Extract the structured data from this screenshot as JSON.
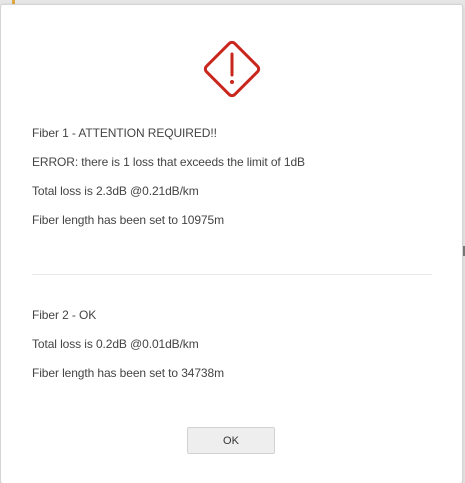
{
  "dialog": {
    "icon": "warning-diamond-icon",
    "icon_color": "#c9261d",
    "fiber1": {
      "lines": [
        "Fiber 1 - ATTENTION REQUIRED!!",
        "ERROR: there is 1 loss that exceeds the limit of 1dB",
        "Total loss is 2.3dB @0.21dB/km",
        "Fiber length has been set to 10975m"
      ]
    },
    "fiber2": {
      "lines": [
        "Fiber 2 - OK",
        "Total loss is 0.2dB @0.01dB/km",
        "Fiber length has been set to 34738m"
      ]
    },
    "ok_label": "OK"
  }
}
